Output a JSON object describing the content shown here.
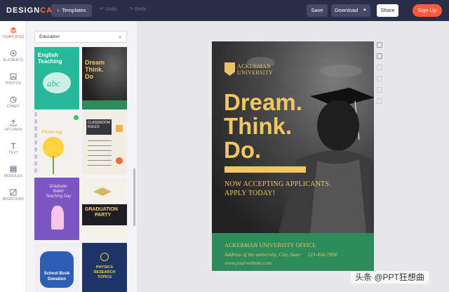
{
  "app": {
    "logo_prefix": "DESIGN",
    "logo_suffix": "CAP"
  },
  "toolbar": {
    "templates_label": "Templates",
    "undo_label": "Undo",
    "redo_label": "Redo",
    "save_label": "Save",
    "download_label": "Download",
    "share_label": "Share",
    "signup_label": "Sign Up"
  },
  "sidebar": {
    "items": [
      {
        "label": "TEMPLATES",
        "icon": "layers-icon"
      },
      {
        "label": "ELEMENTS",
        "icon": "elements-icon"
      },
      {
        "label": "PHOTOS",
        "icon": "photo-icon"
      },
      {
        "label": "CHART",
        "icon": "chart-icon"
      },
      {
        "label": "UPLOADS",
        "icon": "upload-icon"
      },
      {
        "label": "TEXT",
        "icon": "text-icon"
      },
      {
        "label": "MODULES",
        "icon": "modules-icon"
      },
      {
        "label": "BKGROUND",
        "icon": "background-icon"
      }
    ]
  },
  "panel": {
    "category": "Education"
  },
  "thumbnails": {
    "t1": {
      "line1": "English",
      "line2": "Teaching"
    },
    "t2": {
      "line1": "Dream",
      "line2": "Think.",
      "line3": "Do"
    },
    "t3": {
      "line1": "Flowering"
    },
    "t4": {
      "line1": "CLASSROOM",
      "line2": "RULES"
    },
    "t5": {
      "line1": "Graduate",
      "line2": "Ballet",
      "line3": "Teaching Day"
    },
    "t6": {
      "line1": "GRADUATION",
      "line2": "PARTY"
    },
    "t7": {
      "line1": "School Book",
      "line2": "Donation"
    },
    "t8": {
      "line1": "PHYSICS",
      "line2": "RESEARCH",
      "line3": "TOPICS"
    }
  },
  "poster": {
    "university_line1": "ACKERMAN",
    "university_line2": "UNIVERSITY",
    "headline1": "Dream.",
    "headline2": "Think.",
    "headline3": "Do.",
    "now_line1": "NOW ACCEPTING APPLICANTS.",
    "now_line2": "APPLY TODAY!",
    "office": "ACKERMAN UNIVERSITY OFFICE",
    "address": "Address of the university, City, State",
    "phone": "123-456-7890",
    "website": "www.yourwebsite.com"
  },
  "watermark": {
    "text": "头条 @PPT狂想曲"
  },
  "colors": {
    "topbar": "#2b2e48",
    "accent": "#ff5a3a",
    "poster_gold": "#efc763",
    "poster_green": "#2e8b5b"
  }
}
